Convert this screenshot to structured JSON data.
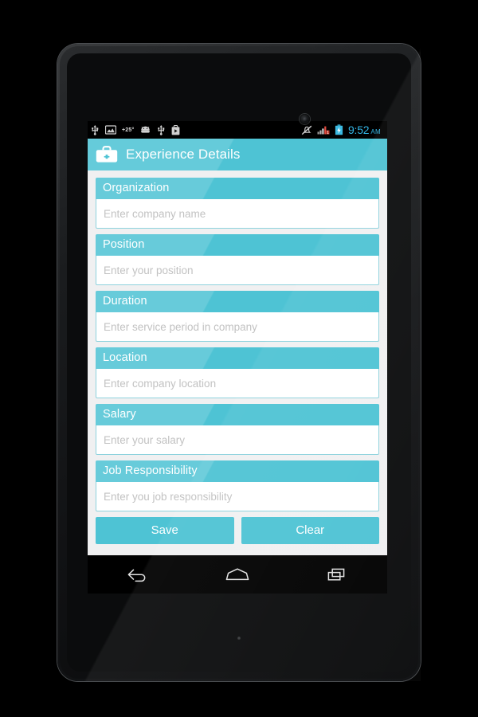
{
  "statusbar": {
    "icons_left": [
      "usb-icon",
      "image-icon",
      "temperature-icon",
      "android-icon",
      "usb-icon",
      "play-store-icon"
    ],
    "temperature": "+25°",
    "icons_right": [
      "notifications-muted-icon",
      "signal-bars-icon",
      "battery-charging-icon"
    ],
    "time": "9:52",
    "ampm": "AM",
    "clock_color": "#33b5e5"
  },
  "appbar": {
    "icon": "briefcase-icon",
    "title": "Experience Details",
    "background": "#4ec3d4"
  },
  "form": {
    "fields": [
      {
        "label": "Organization",
        "placeholder": "Enter company name",
        "value": ""
      },
      {
        "label": "Position",
        "placeholder": "Enter your position",
        "value": ""
      },
      {
        "label": "Duration",
        "placeholder": "Enter service period in company",
        "value": ""
      },
      {
        "label": "Location",
        "placeholder": "Enter company location",
        "value": ""
      },
      {
        "label": "Salary",
        "placeholder": "Enter your salary",
        "value": ""
      },
      {
        "label": "Job Responsibility",
        "placeholder": "Enter you job responsibility",
        "value": ""
      }
    ],
    "buttons": {
      "save": "Save",
      "clear": "Clear"
    },
    "accent": "#4ec3d4",
    "background": "#f0f0f1"
  },
  "navbar": {
    "back": "back-icon",
    "home": "home-icon",
    "recents": "recents-icon"
  }
}
